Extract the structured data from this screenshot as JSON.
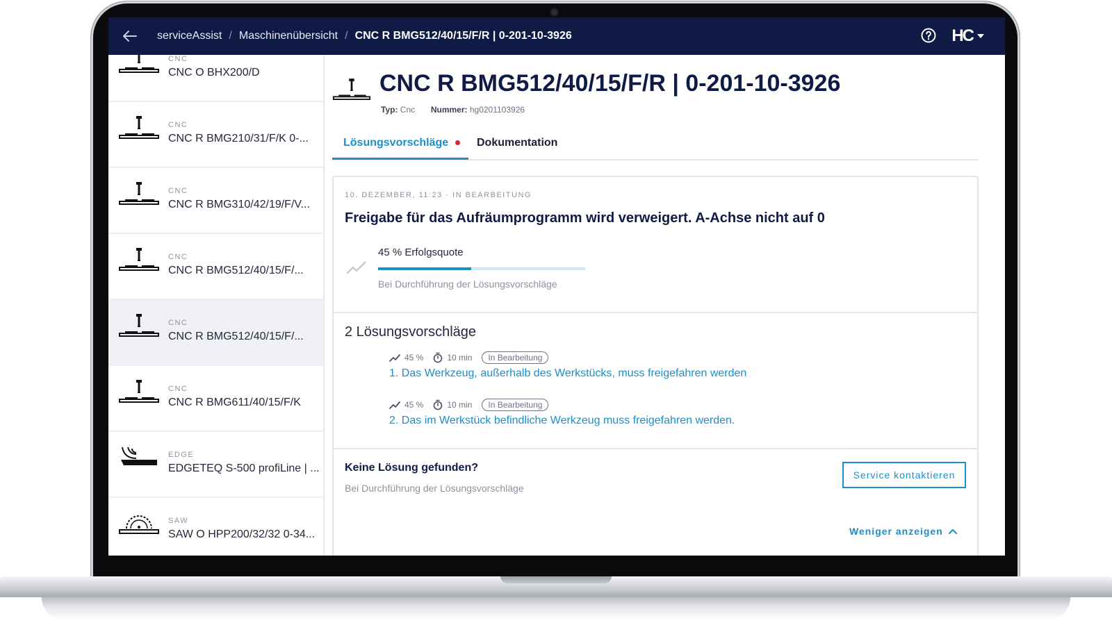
{
  "header": {
    "crumbs": [
      "serviceAssist",
      "Maschinenübersicht",
      "CNC R BMG512/40/15/F/R | 0-201-10-3926"
    ],
    "logo": "HC"
  },
  "sidebar": {
    "items": [
      {
        "category": "CNC",
        "name": "CNC O BHX200/D",
        "icon": "cnc-machine-icon"
      },
      {
        "category": "CNC",
        "name": "CNC R BMG210/31/F/K 0-...",
        "icon": "cnc-machine-icon"
      },
      {
        "category": "CNC",
        "name": "CNC R BMG310/42/19/F/V...",
        "icon": "cnc-machine-icon"
      },
      {
        "category": "CNC",
        "name": "CNC R BMG512/40/15/F/...",
        "icon": "cnc-machine-icon"
      },
      {
        "category": "CNC",
        "name": "CNC R BMG512/40/15/F/...",
        "icon": "cnc-machine-icon"
      },
      {
        "category": "CNC",
        "name": "CNC R BMG611/40/15/F/K",
        "icon": "cnc-machine-icon"
      },
      {
        "category": "EDGE",
        "name": "EDGETEQ S-500 profiLine | ...",
        "icon": "edge-machine-icon"
      },
      {
        "category": "SAW",
        "name": "SAW O HPP200/32/32 0-34...",
        "icon": "saw-machine-icon"
      }
    ]
  },
  "main": {
    "title": "CNC R BMG512/40/15/F/R | 0-201-10-3926",
    "meta": {
      "type_label": "Typ:",
      "type_value": "Cnc",
      "number_label": "Nummer:",
      "number_value": "hg0201103926"
    },
    "tabs": [
      {
        "label": "Lösungsvorschläge"
      },
      {
        "label": "Dokumentation"
      }
    ],
    "issue": {
      "status": "10. DEZEMBER, 11:23 · IN BEARBEITUNG",
      "title": "Freigabe für das Aufräumprogramm wird verweigert. A-Achse nicht auf 0",
      "success_rate_label": "45 % Erfolgsquote",
      "success_rate": 0.45,
      "success_sub": "Bei Durchführung der Lösungsvorschläge"
    },
    "solutions": {
      "title": "2 Lösungsvorschläge",
      "items": [
        {
          "rate": "45 %",
          "time": "10 min",
          "status": "In Bearbeitung",
          "text": "1. Das Werkzeug, außerhalb des Werkstücks, muss freigefahren werden"
        },
        {
          "rate": "45 %",
          "time": "10 min",
          "status": "In Bearbeitung",
          "text": "2. Das im Werkstück befindliche Werkzeug muss freigefahren werden."
        }
      ]
    },
    "no_solution": {
      "title": "Keine Lösung gefunden?",
      "sub": "Bei Durchführung der Lösungsvorschläge",
      "button": "Service kontaktieren",
      "less": "Weniger anzeigen"
    }
  },
  "colors": {
    "header": "#0f1b45",
    "accent": "#1b8fc9",
    "alert": "#e0242e"
  }
}
